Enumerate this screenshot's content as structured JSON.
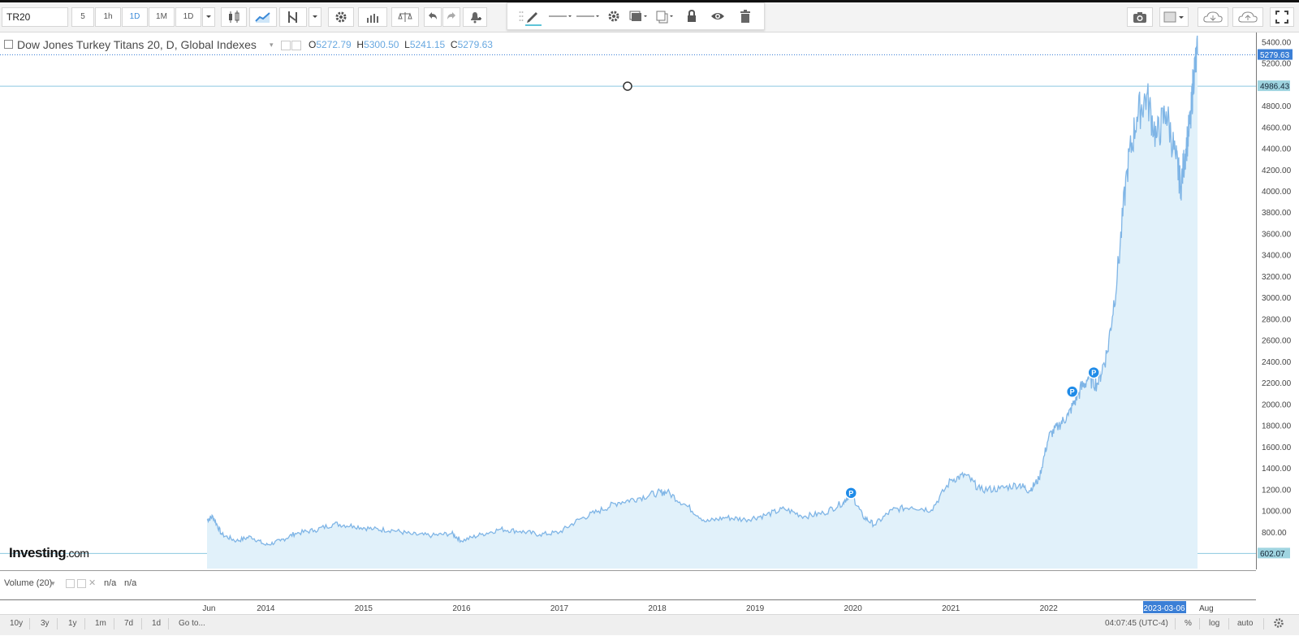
{
  "toolbar": {
    "symbol": "TR20",
    "intervals": [
      "5",
      "1h",
      "1D",
      "1M",
      "1D"
    ],
    "active_interval": "1D",
    "icons": [
      "candles-icon",
      "area-chart-icon",
      "indicators-icon",
      "dropdown-icon",
      "settings-icon",
      "bar-chart-icon",
      "compare-icon",
      "undo-icon",
      "redo-icon",
      "alert-icon"
    ],
    "right_icons": [
      "camera-icon",
      "layout-icon",
      "cloud-load-icon",
      "cloud-save-icon",
      "fullscreen-icon"
    ]
  },
  "drawing_toolbar": {
    "icons": [
      "pencil-icon",
      "line-style-icon",
      "line-width-icon",
      "gear-icon",
      "layers-icon",
      "copy-icon",
      "lock-icon",
      "eye-icon",
      "trash-icon"
    ]
  },
  "legend": {
    "title": "Dow Jones Turkey Titans 20, D, Global Indexes",
    "open_label": "O",
    "open": "5272.79",
    "high_label": "H",
    "high": "5300.50",
    "low_label": "L",
    "low": "5241.15",
    "close_label": "C",
    "close": "5279.63"
  },
  "volume": {
    "label": "Volume (20)",
    "value1": "n/a",
    "value2": "n/a"
  },
  "watermark": {
    "brand": "Investing",
    "suffix": ".com"
  },
  "bottom_bar": {
    "ranges": [
      "10y",
      "3y",
      "1y",
      "1m",
      "7d",
      "1d"
    ],
    "goto": "Go to...",
    "clock": "04:07:45 (UTC-4)",
    "percent": "%",
    "log": "log",
    "auto": "auto"
  },
  "colors": {
    "line": "#7fb5e6",
    "fill": "#e1f1fa",
    "horizontal_line": "#8cc8e0",
    "last_price_badge": "#3b7fd6",
    "level_badge": "#9fd4e0",
    "marker": "#1f8be8"
  },
  "chart_data": {
    "type": "area",
    "title": "Dow Jones Turkey Titans 20, D, Global Indexes",
    "x_tick_labels": [
      "Jun",
      "2014",
      "2015",
      "2016",
      "2017",
      "2018",
      "2019",
      "2020",
      "2021",
      "2022",
      "2023-03-06",
      "Aug"
    ],
    "y_tick_labels": [
      "5400.00",
      "5200.00",
      "4800.00",
      "4600.00",
      "4400.00",
      "4200.00",
      "4000.00",
      "3800.00",
      "3600.00",
      "3400.00",
      "3200.00",
      "3000.00",
      "2800.00",
      "2600.00",
      "2400.00",
      "2200.00",
      "2000.00",
      "1800.00",
      "1600.00",
      "1400.00",
      "1200.00",
      "1000.00",
      "800.00"
    ],
    "ylim": [
      460,
      5490
    ],
    "last_price": "5279.63",
    "horizontal_levels": [
      {
        "label": "4986.43",
        "value": 4986.43
      },
      {
        "label": "602.07",
        "value": 602.07
      }
    ],
    "crosshair_date": "2023-03-06",
    "markers": [
      {
        "label": "P",
        "x": 2019.98,
        "y": 1170
      },
      {
        "label": "P",
        "x": 2022.24,
        "y": 2120
      },
      {
        "label": "P",
        "x": 2022.46,
        "y": 2300
      }
    ],
    "x": [
      2013.4,
      2013.46,
      2013.55,
      2013.7,
      2013.85,
      2014.0,
      2014.15,
      2014.3,
      2014.5,
      2014.7,
      2014.9,
      2015.1,
      2015.3,
      2015.5,
      2015.7,
      2015.9,
      2016.0,
      2016.2,
      2016.4,
      2016.6,
      2016.8,
      2017.0,
      2017.2,
      2017.4,
      2017.6,
      2017.8,
      2018.0,
      2018.1,
      2018.3,
      2018.5,
      2018.7,
      2018.9,
      2019.1,
      2019.3,
      2019.5,
      2019.7,
      2019.9,
      2019.98,
      2020.1,
      2020.22,
      2020.4,
      2020.6,
      2020.8,
      2021.0,
      2021.15,
      2021.3,
      2021.5,
      2021.7,
      2021.8,
      2021.9,
      2022.0,
      2022.1,
      2022.2,
      2022.3,
      2022.4,
      2022.5,
      2022.6,
      2022.7,
      2022.8,
      2022.9,
      2023.0,
      2023.1,
      2023.2,
      2023.3,
      2023.35,
      2023.4,
      2023.45,
      2023.48,
      2023.52
    ],
    "y": [
      915,
      950,
      780,
      720,
      760,
      680,
      720,
      790,
      820,
      880,
      860,
      830,
      820,
      780,
      770,
      790,
      720,
      780,
      830,
      810,
      780,
      800,
      920,
      1000,
      1080,
      1120,
      1170,
      1180,
      1050,
      900,
      940,
      920,
      960,
      1020,
      950,
      980,
      1080,
      1170,
      950,
      870,
      1010,
      1040,
      1010,
      1290,
      1340,
      1200,
      1210,
      1250,
      1190,
      1300,
      1700,
      1800,
      1900,
      2100,
      2250,
      2200,
      2500,
      3200,
      4200,
      4700,
      4900,
      4500,
      4750,
      4300,
      4050,
      4400,
      4650,
      5100,
      5280
    ]
  }
}
